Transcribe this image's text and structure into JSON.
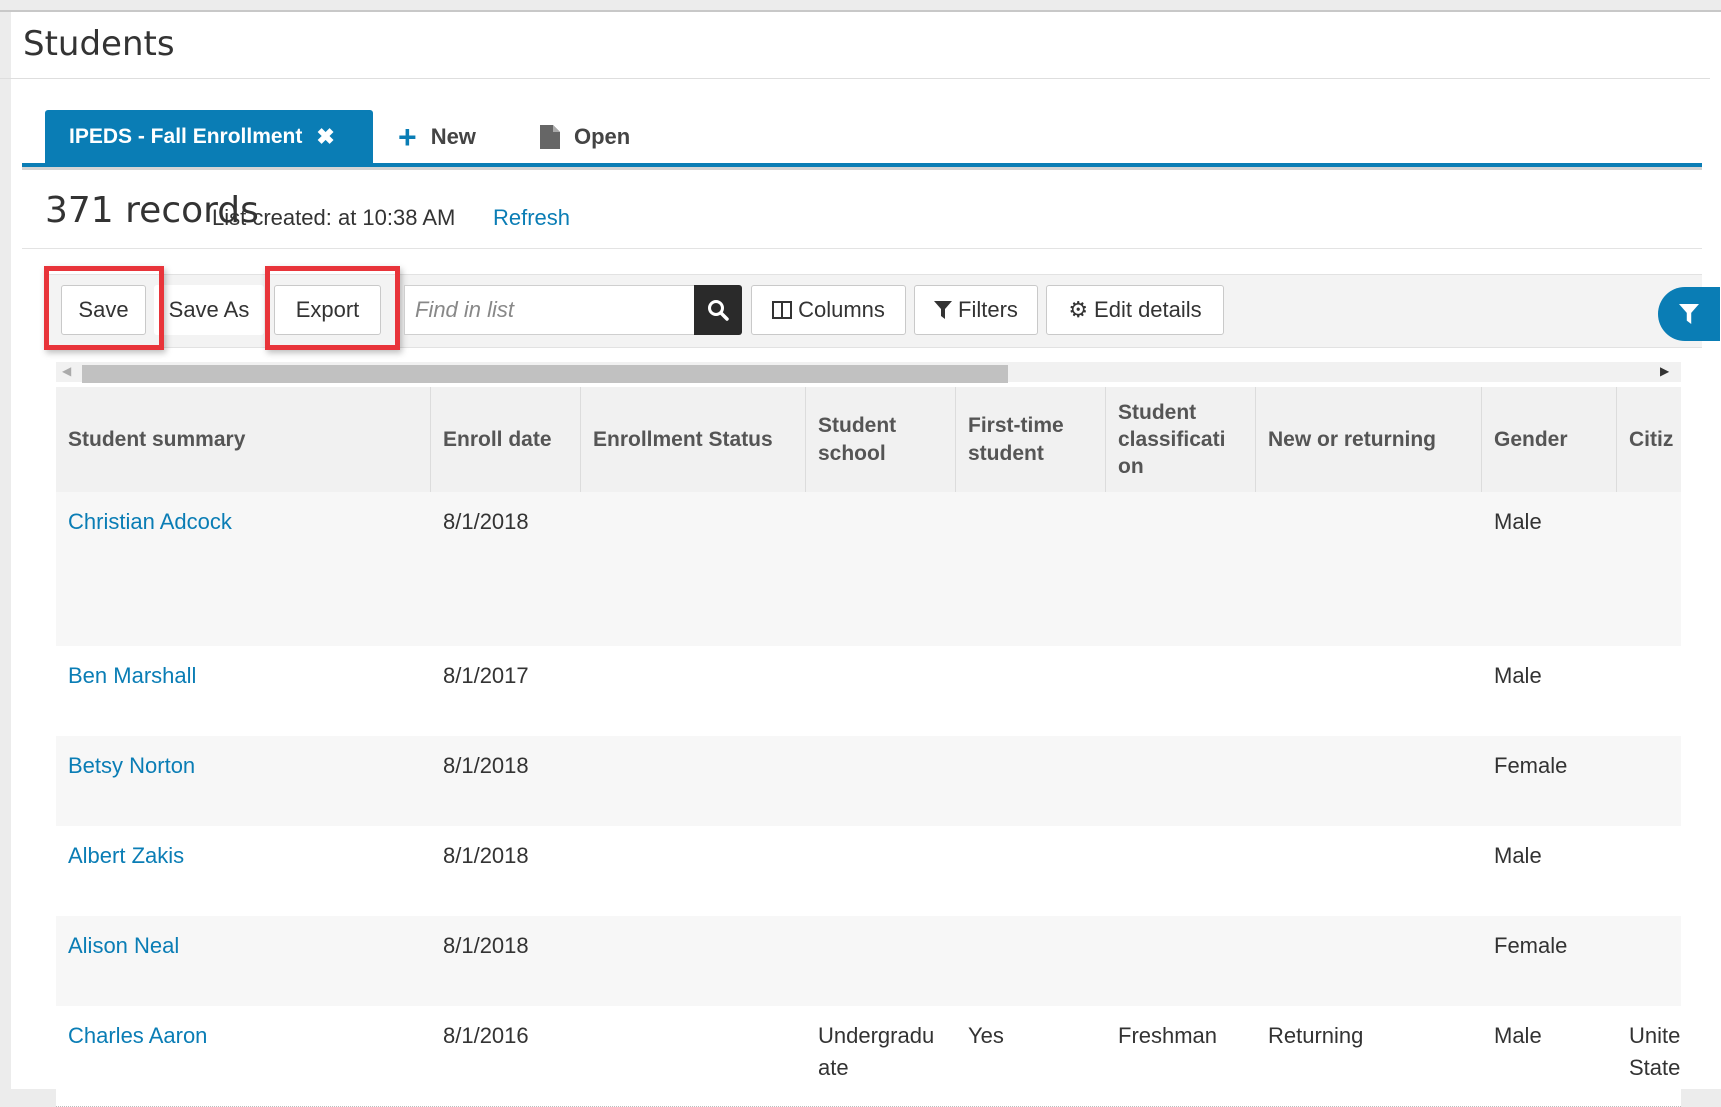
{
  "page": {
    "title": "Students"
  },
  "tabs": {
    "active": "IPEDS - Fall Enrollment",
    "close_icon": "✖",
    "new_label": "New",
    "open_label": "Open"
  },
  "summary": {
    "records": "371 records",
    "list_created": "List created: at 10:38 AM",
    "refresh": "Refresh"
  },
  "toolbar": {
    "save": "Save",
    "save_as": "Save As",
    "export": "Export",
    "search_placeholder": "Find in list",
    "columns": "Columns",
    "filters": "Filters",
    "edit_details": "Edit details"
  },
  "colors": {
    "accent": "#0a7db5",
    "highlight": "#e8343a"
  },
  "table": {
    "headers": [
      "Student summary",
      "Enroll date",
      "Enrollment Status",
      "Student school",
      "First-time student",
      "Student classificati on",
      "New or returning",
      "Gender",
      "Citiz"
    ],
    "rows": [
      {
        "name": "Christian Adcock",
        "enroll_date": "8/1/2018",
        "status": "",
        "school": "",
        "first_time": "",
        "classification": "",
        "new_returning": "",
        "gender": "Male",
        "citizenship": ""
      },
      {
        "name": "Ben Marshall",
        "enroll_date": "8/1/2017",
        "status": "",
        "school": "",
        "first_time": "",
        "classification": "",
        "new_returning": "",
        "gender": "Male",
        "citizenship": ""
      },
      {
        "name": "Betsy Norton",
        "enroll_date": "8/1/2018",
        "status": "",
        "school": "",
        "first_time": "",
        "classification": "",
        "new_returning": "",
        "gender": "Female",
        "citizenship": ""
      },
      {
        "name": "Albert Zakis",
        "enroll_date": "8/1/2018",
        "status": "",
        "school": "",
        "first_time": "",
        "classification": "",
        "new_returning": "",
        "gender": "Male",
        "citizenship": ""
      },
      {
        "name": "Alison Neal",
        "enroll_date": "8/1/2018",
        "status": "",
        "school": "",
        "first_time": "",
        "classification": "",
        "new_returning": "",
        "gender": "Female",
        "citizenship": ""
      },
      {
        "name": "Charles Aaron",
        "enroll_date": "8/1/2016",
        "status": "",
        "school": "Undergradu ate",
        "first_time": "Yes",
        "classification": "Freshman",
        "new_returning": "Returning",
        "gender": "Male",
        "citizenship": "Unite State"
      }
    ]
  }
}
